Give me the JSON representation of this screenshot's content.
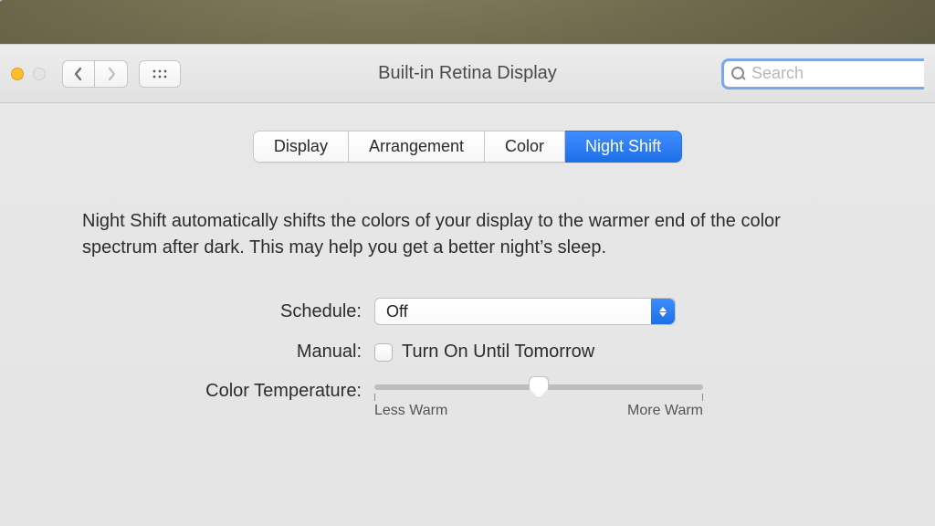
{
  "window": {
    "title": "Built-in Retina Display"
  },
  "search": {
    "placeholder": "Search",
    "value": ""
  },
  "tabs": [
    {
      "label": "Display",
      "active": false
    },
    {
      "label": "Arrangement",
      "active": false
    },
    {
      "label": "Color",
      "active": false
    },
    {
      "label": "Night Shift",
      "active": true
    }
  ],
  "nightshift": {
    "blurb": "Night Shift automatically shifts the colors of your display to the warmer end of the color spectrum after dark. This may help you get a better night’s sleep.",
    "schedule_label": "Schedule:",
    "schedule_value": "Off",
    "manual_label": "Manual:",
    "manual_checkbox_label": "Turn On Until Tomorrow",
    "manual_checked": false,
    "color_temp_label": "Color Temperature:",
    "slider": {
      "min_label": "Less Warm",
      "max_label": "More Warm",
      "value": 0.5
    }
  },
  "icons": {
    "back": "chevron-left",
    "forward": "chevron-right",
    "grid": "grid",
    "search": "magnifier"
  }
}
